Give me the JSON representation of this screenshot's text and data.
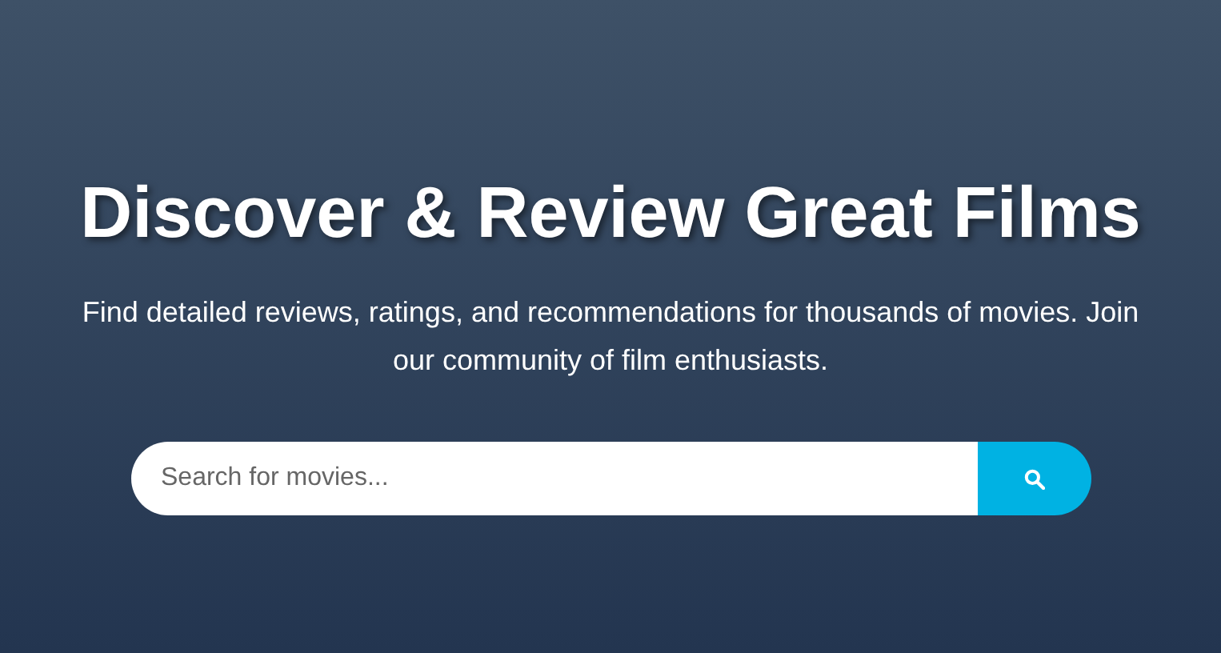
{
  "hero": {
    "title": "Discover & Review Great Films",
    "subtitle": "Find detailed reviews, ratings, and recommendations for thousands of movies. Join our community of film enthusiasts."
  },
  "search": {
    "placeholder": "Search for movies..."
  }
}
